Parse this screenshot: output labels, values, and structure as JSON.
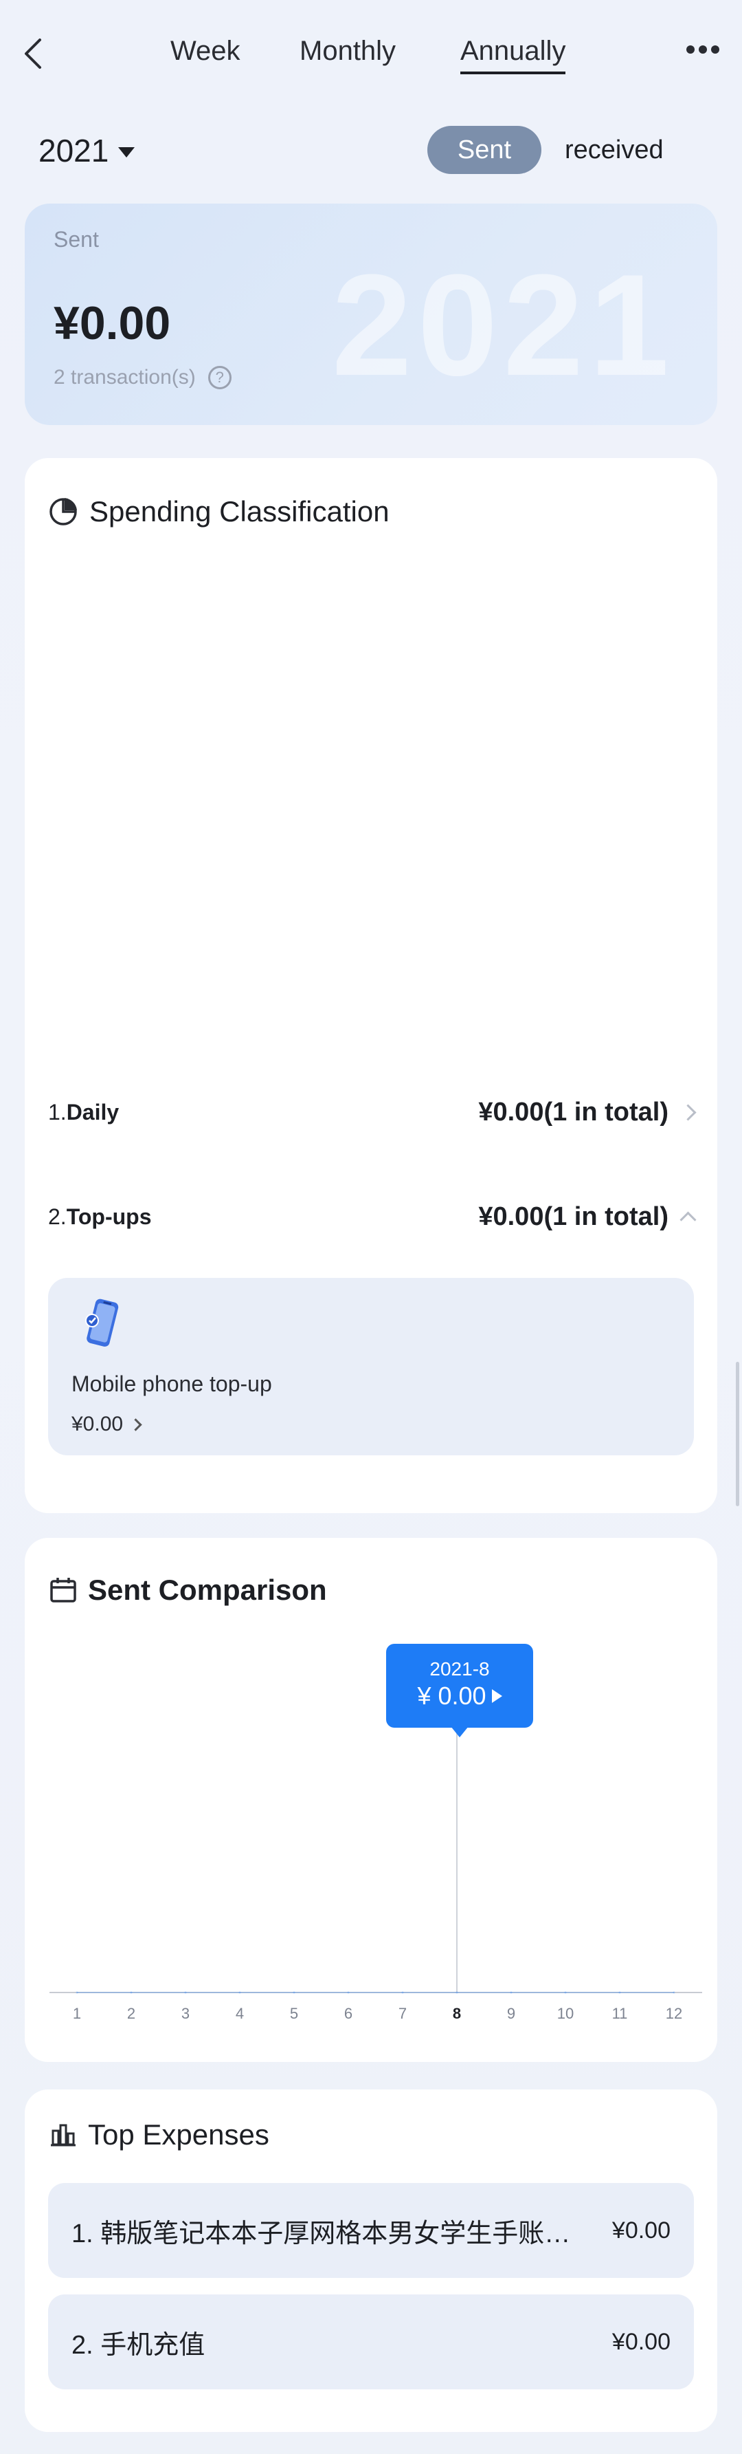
{
  "nav": {
    "tabs": [
      {
        "label": "Week"
      },
      {
        "label": "Monthly"
      },
      {
        "label": "Annually"
      }
    ],
    "active_tab": "Annually"
  },
  "filter": {
    "year": "2021",
    "toggle_sent": "Sent",
    "toggle_received": "received"
  },
  "summary": {
    "label": "Sent",
    "amount": "¥0.00",
    "count": "2 transaction(s)",
    "watermark": "2021",
    "help": "?"
  },
  "spending": {
    "title": "Spending Classification",
    "categories": [
      {
        "index": "1.",
        "name": "Daily",
        "amount": "¥0.00(1 in total)"
      },
      {
        "index": "2.",
        "name": "Top-ups",
        "amount": "¥0.00(1 in total)"
      }
    ],
    "sub_item": {
      "name": "Mobile phone top-up",
      "amount": "¥0.00"
    }
  },
  "comparison": {
    "title": "Sent Comparison",
    "tooltip": {
      "period": "2021-8",
      "value": "¥ 0.00"
    }
  },
  "chart_data": {
    "type": "line",
    "title": "Sent Comparison",
    "x": [
      "1",
      "2",
      "3",
      "4",
      "5",
      "6",
      "7",
      "8",
      "9",
      "10",
      "11",
      "12"
    ],
    "selected": "8",
    "series": [
      {
        "values": [
          0,
          0,
          0,
          0,
          0,
          0,
          0,
          0,
          0,
          0,
          0,
          0
        ]
      }
    ]
  },
  "top_expenses": {
    "title": "Top Expenses",
    "items": [
      {
        "name": "1. 韩版笔记本本子厚网格本男女学生手账…",
        "amount": "¥0.00"
      },
      {
        "name": "2. 手机充值",
        "amount": "¥0.00"
      }
    ]
  },
  "colors": {
    "accent": "#1e7cf6",
    "toggle_active": "#7c8fab",
    "card_bg": "#ffffff",
    "page_bg": "#eef2fa"
  }
}
